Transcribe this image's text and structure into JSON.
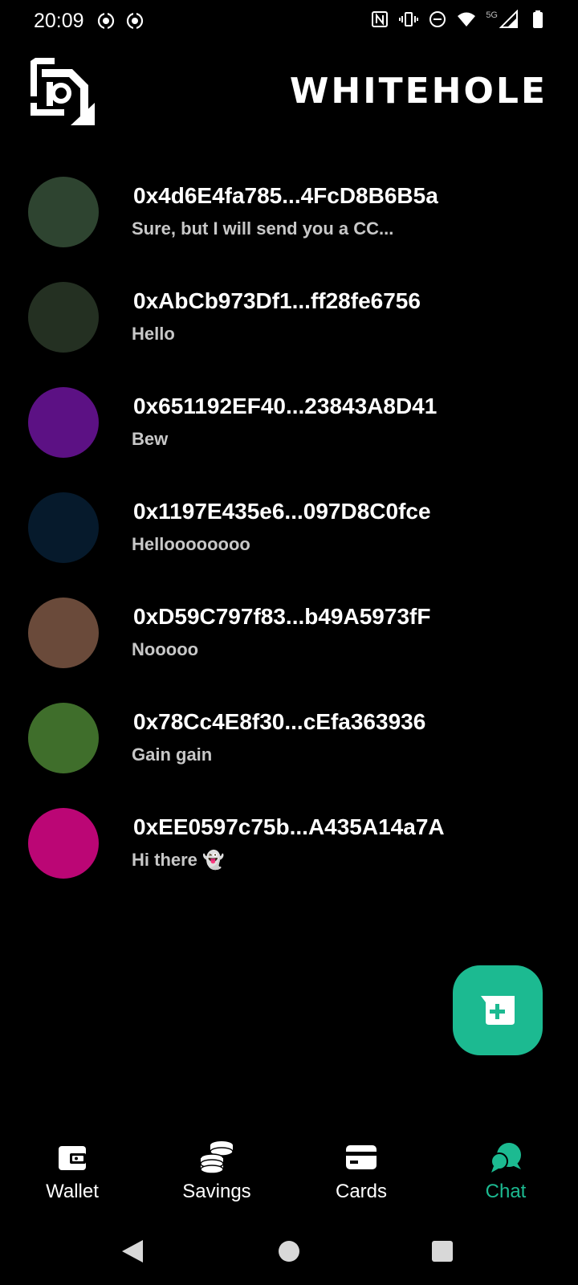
{
  "status_bar": {
    "time": "20:09",
    "left_icons": [
      "hotspot-icon",
      "hotspot-icon"
    ],
    "right_icons": [
      "nfc-icon",
      "vibrate-icon",
      "dnd-icon",
      "wifi-icon",
      "signal-5g-icon",
      "battery-icon"
    ],
    "network_label": "5G"
  },
  "header": {
    "title": "WHITEHOLE",
    "logo_icon": "whitehole-logo-icon"
  },
  "chats": [
    {
      "address": "0x4d6E4fa785...4FcD8B6B5a",
      "message": "Sure, but I will send you a CC...",
      "avatar_color": "#2e4430"
    },
    {
      "address": "0xAbCb973Df1...ff28fe6756",
      "message": "Hello",
      "avatar_color": "#243022"
    },
    {
      "address": "0x651192EF40...23843A8D41",
      "message": "Bew",
      "avatar_color": "#5c1184"
    },
    {
      "address": "0x1197E435e6...097D8C0fce",
      "message": "Helloooooooo",
      "avatar_color": "#061a2c"
    },
    {
      "address": "0xD59C797f83...b49A5973fF",
      "message": "Nooooo",
      "avatar_color": "#6a4a3a"
    },
    {
      "address": "0x78Cc4E8f30...cEfa363936",
      "message": "Gain gain",
      "avatar_color": "#3f6e2b"
    },
    {
      "address": "0xEE0597c75b...A435A14a7A",
      "message": "Hi there 👻",
      "avatar_color": "#bb0675"
    }
  ],
  "fab": {
    "icon": "new-chat-icon",
    "color": "#1cba91"
  },
  "bottom_nav": [
    {
      "label": "Wallet",
      "icon": "wallet-icon",
      "active": false
    },
    {
      "label": "Savings",
      "icon": "coins-icon",
      "active": false
    },
    {
      "label": "Cards",
      "icon": "card-icon",
      "active": false
    },
    {
      "label": "Chat",
      "icon": "chat-bubbles-icon",
      "active": true
    }
  ],
  "colors": {
    "accent": "#1cba91",
    "background": "#000000",
    "muted_text": "#c8c8c8"
  }
}
